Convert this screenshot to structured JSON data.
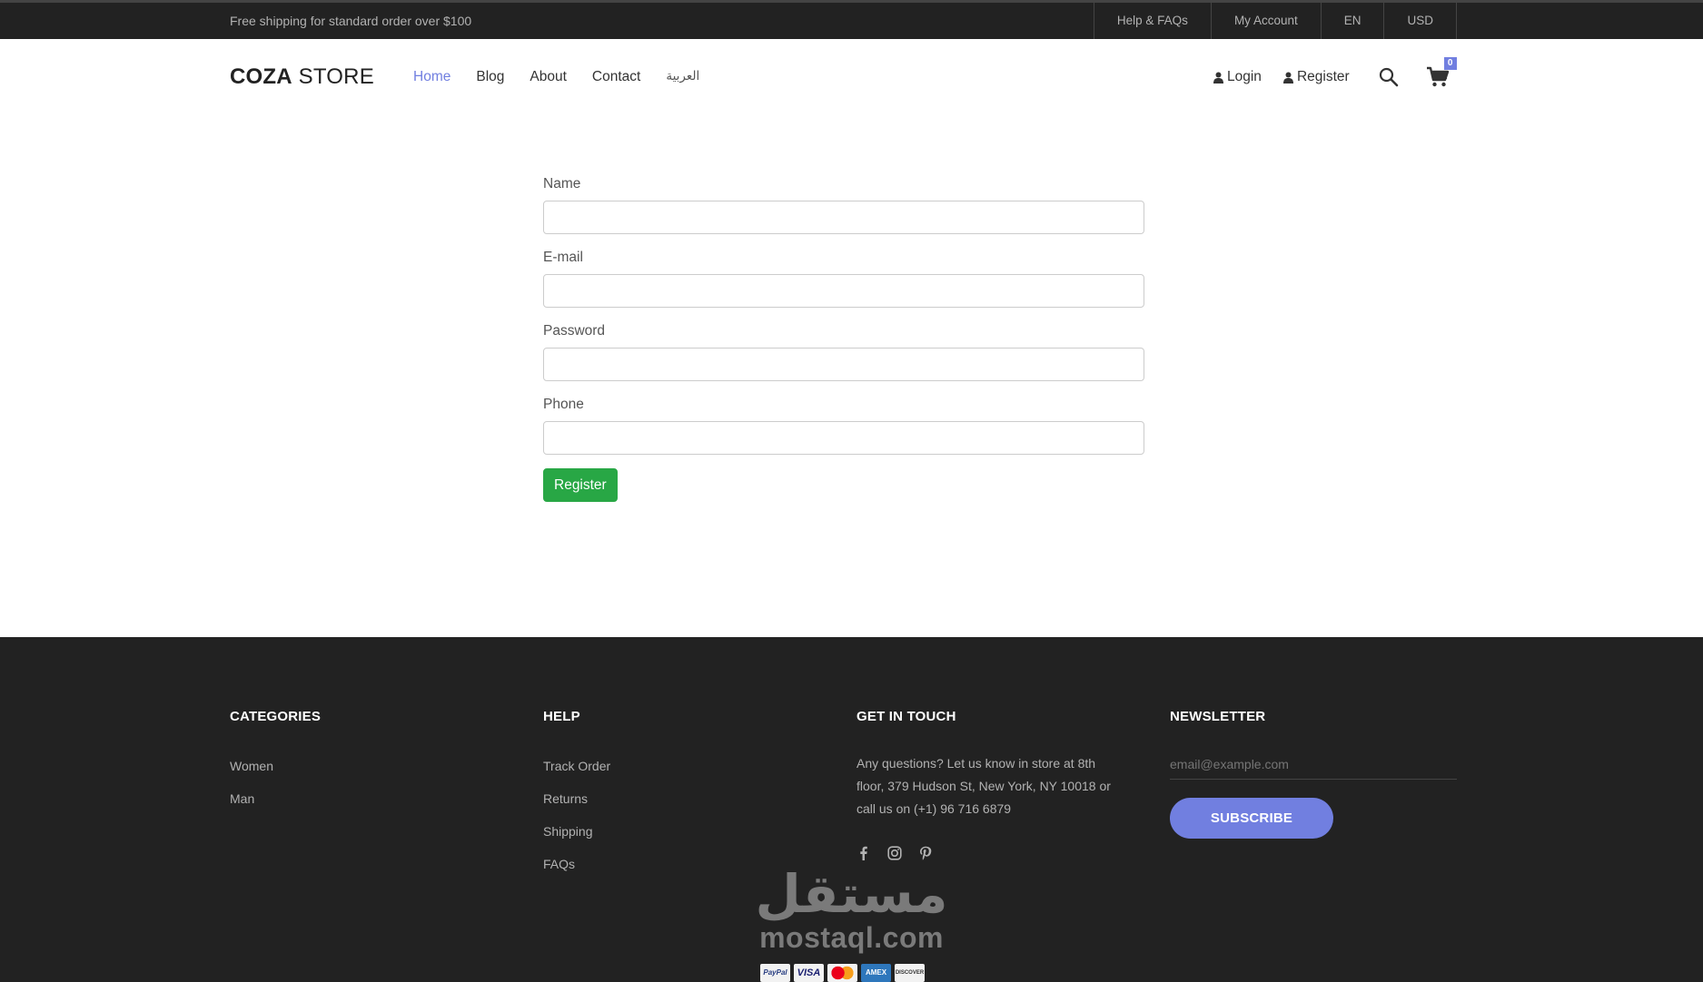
{
  "topbar": {
    "shipping_text": "Free shipping for standard order over $100",
    "links": [
      "Help & FAQs",
      "My Account",
      "EN",
      "USD"
    ]
  },
  "header": {
    "logo_bold": "COZA",
    "logo_rest": " STORE",
    "nav": [
      "Home",
      "Blog",
      "About",
      "Contact",
      "العربية"
    ],
    "active_nav": "Home",
    "login_label": "Login",
    "register_label": "Register",
    "cart_count": "0"
  },
  "form": {
    "name_label": "Name",
    "email_label": "E-mail",
    "password_label": "Password",
    "phone_label": "Phone",
    "name_value": "",
    "email_value": "",
    "password_value": "",
    "phone_value": "",
    "submit_label": "Register"
  },
  "footer": {
    "categories": {
      "title": "CATEGORIES",
      "items": [
        "Women",
        "Man"
      ]
    },
    "help": {
      "title": "HELP",
      "items": [
        "Track Order",
        "Returns",
        "Shipping",
        "FAQs"
      ]
    },
    "touch": {
      "title": "GET IN TOUCH",
      "text": "Any questions? Let us know in store at 8th floor, 379 Hudson St, New York, NY 10018 or call us on (+1) 96 716 6879",
      "social": [
        "facebook-icon",
        "instagram-icon",
        "pinterest-icon"
      ]
    },
    "newsletter": {
      "title": "NEWSLETTER",
      "placeholder": "email@example.com",
      "button": "SUBSCRIBE"
    },
    "payments": [
      "PayPal",
      "VISA",
      "MC",
      "AMEX",
      "DISCOVER"
    ]
  },
  "watermark": {
    "arabic": "مستقل",
    "latin": "mostaql.com"
  },
  "colors": {
    "accent": "#717fe0",
    "success": "#28a745",
    "dark": "#222222",
    "muted_text": "#b2b2b2"
  }
}
